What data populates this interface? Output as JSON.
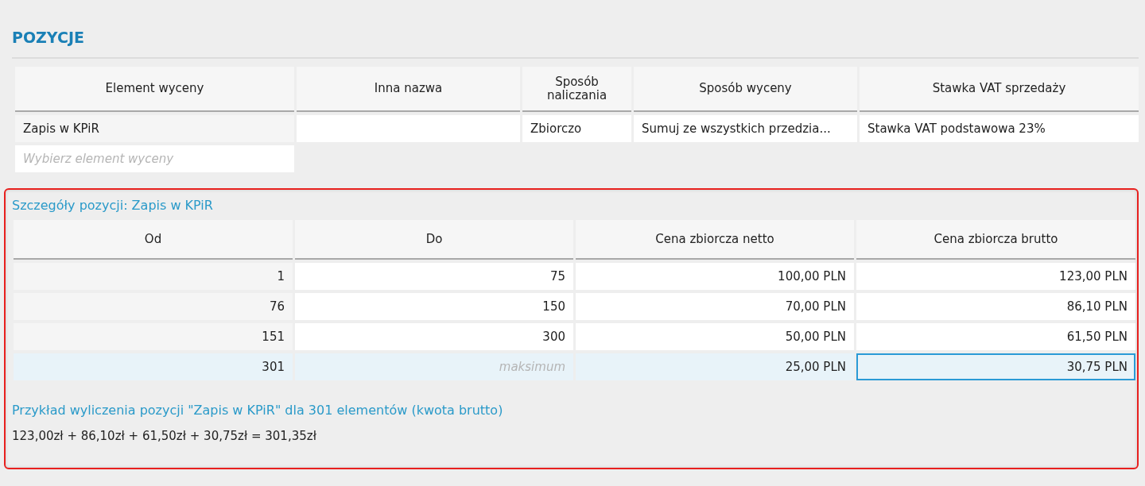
{
  "section_title": "POZYCJE",
  "positions": {
    "columns": [
      "Element wyceny",
      "Inna nazwa",
      "Sposób naliczania",
      "Sposób wyceny",
      "Stawka VAT sprzedaży"
    ],
    "rows": [
      {
        "cells": [
          "Zapis w KPiR",
          "",
          "Zbiorczo",
          "Sumuj ze wszystkich przedzia...",
          "Stawka VAT podstawowa 23%"
        ]
      }
    ],
    "new_item": {
      "placeholder": "Wybierz element wyceny"
    }
  },
  "details": {
    "title": "Szczegóły pozycji: Zapis w KPiR",
    "columns": [
      "Od",
      "Do",
      "Cena zbiorcza netto",
      "Cena zbiorcza brutto"
    ],
    "rows": [
      {
        "selected": false,
        "cells": [
          {
            "value": "1",
            "focused": false
          },
          {
            "value": "75",
            "focused": false
          },
          {
            "value": "100,00 PLN",
            "focused": false
          },
          {
            "value": "123,00 PLN",
            "focused": false
          }
        ]
      },
      {
        "selected": false,
        "cells": [
          {
            "value": "76",
            "focused": false
          },
          {
            "value": "150",
            "focused": false
          },
          {
            "value": "70,00 PLN",
            "focused": false
          },
          {
            "value": "86,10 PLN",
            "focused": false
          }
        ]
      },
      {
        "selected": false,
        "cells": [
          {
            "value": "151",
            "focused": false
          },
          {
            "value": "300",
            "focused": false
          },
          {
            "value": "50,00 PLN",
            "focused": false
          },
          {
            "value": "61,50 PLN",
            "focused": false
          }
        ]
      },
      {
        "selected": true,
        "cells": [
          {
            "value": "301",
            "focused": false
          },
          {
            "placeholder": "maksimum",
            "focused": false
          },
          {
            "value": "25,00 PLN",
            "focused": false
          },
          {
            "value": "30,75 PLN",
            "focused": true
          }
        ]
      }
    ],
    "example_title": "Przykład wyliczenia pozycji \"Zapis w KPiR\" dla 301 elementów (kwota brutto)",
    "example_formula": "123,00zł + 86,10zł + 61,50zł + 30,75zł = 301,35zł"
  }
}
